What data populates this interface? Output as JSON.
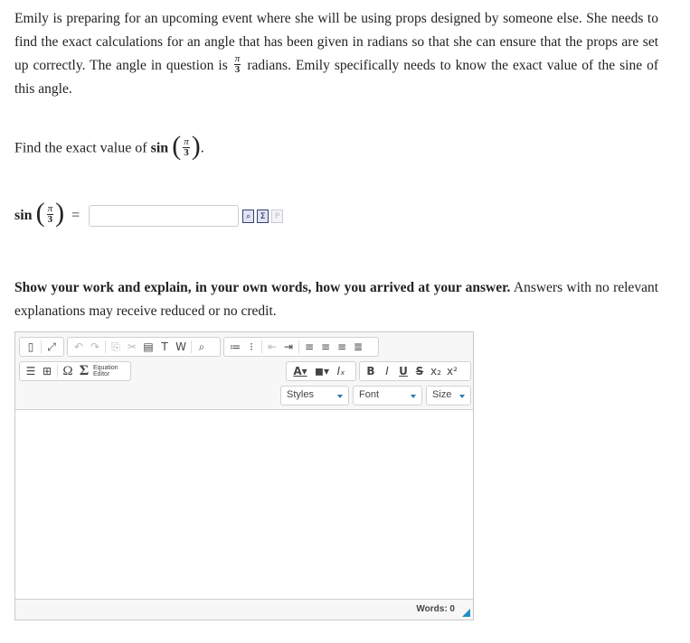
{
  "problem": {
    "text_before": "Emily is preparing for an upcoming event where she will be using props designed by someone else. She needs to find the exact calculations for an angle that has been given in radians so that she can ensure that the props are set up correctly. The angle in question is",
    "angle_num": "π",
    "angle_den": "3",
    "text_after": "radians. Emily specifically needs to know the exact value of the sine of this angle."
  },
  "question": {
    "prefix": "Find the exact value of",
    "func": "sin",
    "num": "π",
    "den": "3",
    "suffix": "."
  },
  "answer": {
    "func": "sin",
    "num": "π",
    "den": "3",
    "equals": "=",
    "value": "",
    "placeholder": "",
    "icons": [
      {
        "name": "preview-icon",
        "glyph": "🔍"
      },
      {
        "name": "equation-icon",
        "glyph": "Σ"
      },
      {
        "name": "paste-icon",
        "glyph": "P"
      }
    ]
  },
  "work": {
    "bold": "Show your work and explain, in your own words, how you arrived at your answer.",
    "normal": " Answers with no relevant explanations may receive reduced or no credit."
  },
  "editor": {
    "toolbar_row1": [
      {
        "name": "source-icon",
        "glyph": "▯"
      },
      {
        "name": "maximize-icon",
        "glyph": "⤢"
      },
      {
        "name": "undo-icon",
        "glyph": "↶"
      },
      {
        "name": "redo-icon",
        "glyph": "↷"
      },
      {
        "name": "copy-icon",
        "glyph": "⎘"
      },
      {
        "name": "cut-icon",
        "glyph": "✂"
      },
      {
        "name": "paste-icon",
        "glyph": "📋"
      },
      {
        "name": "paste-text-icon",
        "glyph": "T"
      },
      {
        "name": "paste-word-icon",
        "glyph": "W"
      },
      {
        "name": "find-icon",
        "glyph": "🔍"
      },
      {
        "name": "numbered-list-icon",
        "glyph": "≡"
      },
      {
        "name": "bulleted-list-icon",
        "glyph": "⁝"
      },
      {
        "name": "outdent-icon",
        "glyph": "⇤"
      },
      {
        "name": "indent-icon",
        "glyph": "⇥"
      },
      {
        "name": "align-left-icon",
        "glyph": "≡"
      },
      {
        "name": "align-center-icon",
        "glyph": "≡"
      },
      {
        "name": "align-right-icon",
        "glyph": "≡"
      },
      {
        "name": "justify-icon",
        "glyph": "≣"
      }
    ],
    "toolbar_row2": [
      {
        "name": "horizontal-line-icon",
        "glyph": "☰"
      },
      {
        "name": "table-icon",
        "glyph": "⊞"
      },
      {
        "name": "special-char-icon",
        "glyph": "Ω"
      },
      {
        "name": "equation-editor-icon",
        "glyph": "Σ"
      }
    ],
    "equation_label_1": "Equation",
    "equation_label_2": "Editor",
    "format_buttons": [
      {
        "name": "text-color-icon",
        "glyph": "A▾"
      },
      {
        "name": "bg-color-icon",
        "glyph": "◼▾"
      },
      {
        "name": "remove-format-icon",
        "glyph": "Iₓ"
      }
    ],
    "style_buttons": [
      {
        "name": "bold-icon",
        "glyph": "B"
      },
      {
        "name": "italic-icon",
        "glyph": "I"
      },
      {
        "name": "underline-icon",
        "glyph": "U"
      },
      {
        "name": "strike-icon",
        "glyph": "S"
      },
      {
        "name": "subscript-icon",
        "glyph": "x₂"
      },
      {
        "name": "superscript-icon",
        "glyph": "x²"
      }
    ],
    "styles_label": "Styles",
    "font_label": "Font",
    "size_label": "Size",
    "words_label": "Words: 0"
  }
}
